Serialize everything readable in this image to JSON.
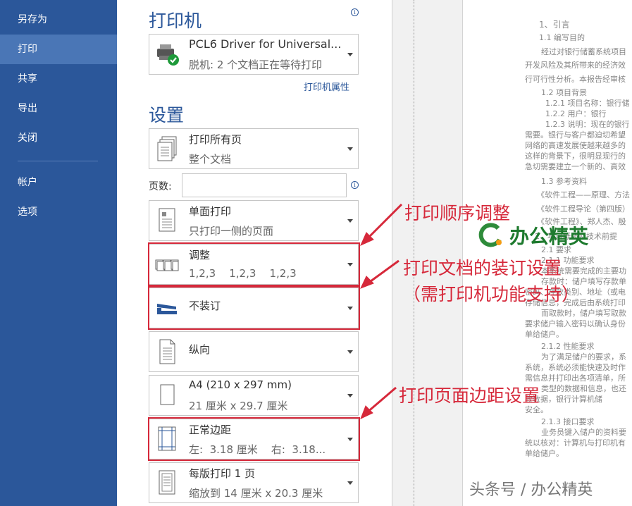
{
  "sidebar": {
    "items": [
      {
        "label": "另存为",
        "active": false
      },
      {
        "label": "打印",
        "active": true
      },
      {
        "label": "共享",
        "active": false
      },
      {
        "label": "导出",
        "active": false
      },
      {
        "label": "关闭",
        "active": false
      },
      {
        "label": "帐户",
        "active": false
      },
      {
        "label": "选项",
        "active": false
      }
    ]
  },
  "printer": {
    "section_title": "打印机",
    "name": "PCL6 Driver for Universal...",
    "status": "脱机: 2 个文档正在等待打印",
    "properties_link": "打印机属性"
  },
  "settings": {
    "section_title": "设置",
    "pages_label": "页数:",
    "pages_value": "",
    "options": [
      {
        "title": "打印所有页",
        "subtitle": "整个文档",
        "icon": "pages-icon"
      },
      {
        "title": "单面打印",
        "subtitle": "只打印一侧的页面",
        "icon": "one-sided-icon"
      },
      {
        "title": "调整",
        "subtitle": "1,2,3    1,2,3    1,2,3",
        "icon": "collate-icon"
      },
      {
        "title": "不装订",
        "subtitle": "",
        "icon": "stapler-icon"
      },
      {
        "title": "纵向",
        "subtitle": "",
        "icon": "portrait-icon"
      },
      {
        "title": "A4 (210 x 297 mm)",
        "subtitle": "21 厘米 x 29.7 厘米",
        "icon": "paper-size-icon"
      },
      {
        "title": "正常边距",
        "subtitle": "左:  3.18 厘米    右:  3.18...",
        "icon": "margins-icon"
      },
      {
        "title": "每版打印 1 页",
        "subtitle": "缩放到 14 厘米 x 20.3 厘米",
        "icon": "pages-per-sheet-icon"
      }
    ]
  },
  "annotations": {
    "order": "打印顺序调整",
    "binding_line1": "打印文档的装订设置",
    "binding_line2": "（需打印机功能支持）",
    "margins": "打印页面边距设置"
  },
  "preview": {
    "lines": [
      "1、引言",
      "1.1 编写目的",
      "经过对银行储蓄系统项目",
      "开发风险及其所带来的经济效",
      "行可行性分析。本报告经审核",
      "1.2 项目背景",
      "1.2.1 项目名称：银行储",
      "1.2.2 用户：银行",
      "1.2.3 说明：现在的银行",
      "需要。银行与客户都迫切希望",
      "网络的高速发展使越来越多的",
      "这样的背景下，很明显现行的",
      "急切需要建立一个新的、高效",
      "1.3 参考资料",
      "《软件工程——原理、方法",
      "《软件工程导论（第四版）",
      "《软件工程》、郑人杰、殷",
      "2、项目概述及技术前提",
      "2.1 要求",
      "2.1.1 功能要求",
      "本系统需要完成的主要功",
      "存款时：储户填写存款单",
      "密码、存款类别、地址（或电",
      "存储信息，完成后由系统打印",
      "而取款时，储户填写取款",
      "要求储户输入密码以确认身份",
      "单给储户。",
      "2.1.2 性能要求",
      "为了满足储户的要求，系",
      "系统，系统必须能快速及时作",
      "需信息并打印出各项清单，所",
      "类型的数据和信息，也还",
      "收数据，银行计算机储",
      "安全。",
      "2.1.3 接口要求",
      "业务员键入储户的资料要",
      "统以核对：计算机与打印机有",
      "单给储户。"
    ],
    "logo_text": "办公精英",
    "watermark": "头条号 / 办公精英"
  }
}
